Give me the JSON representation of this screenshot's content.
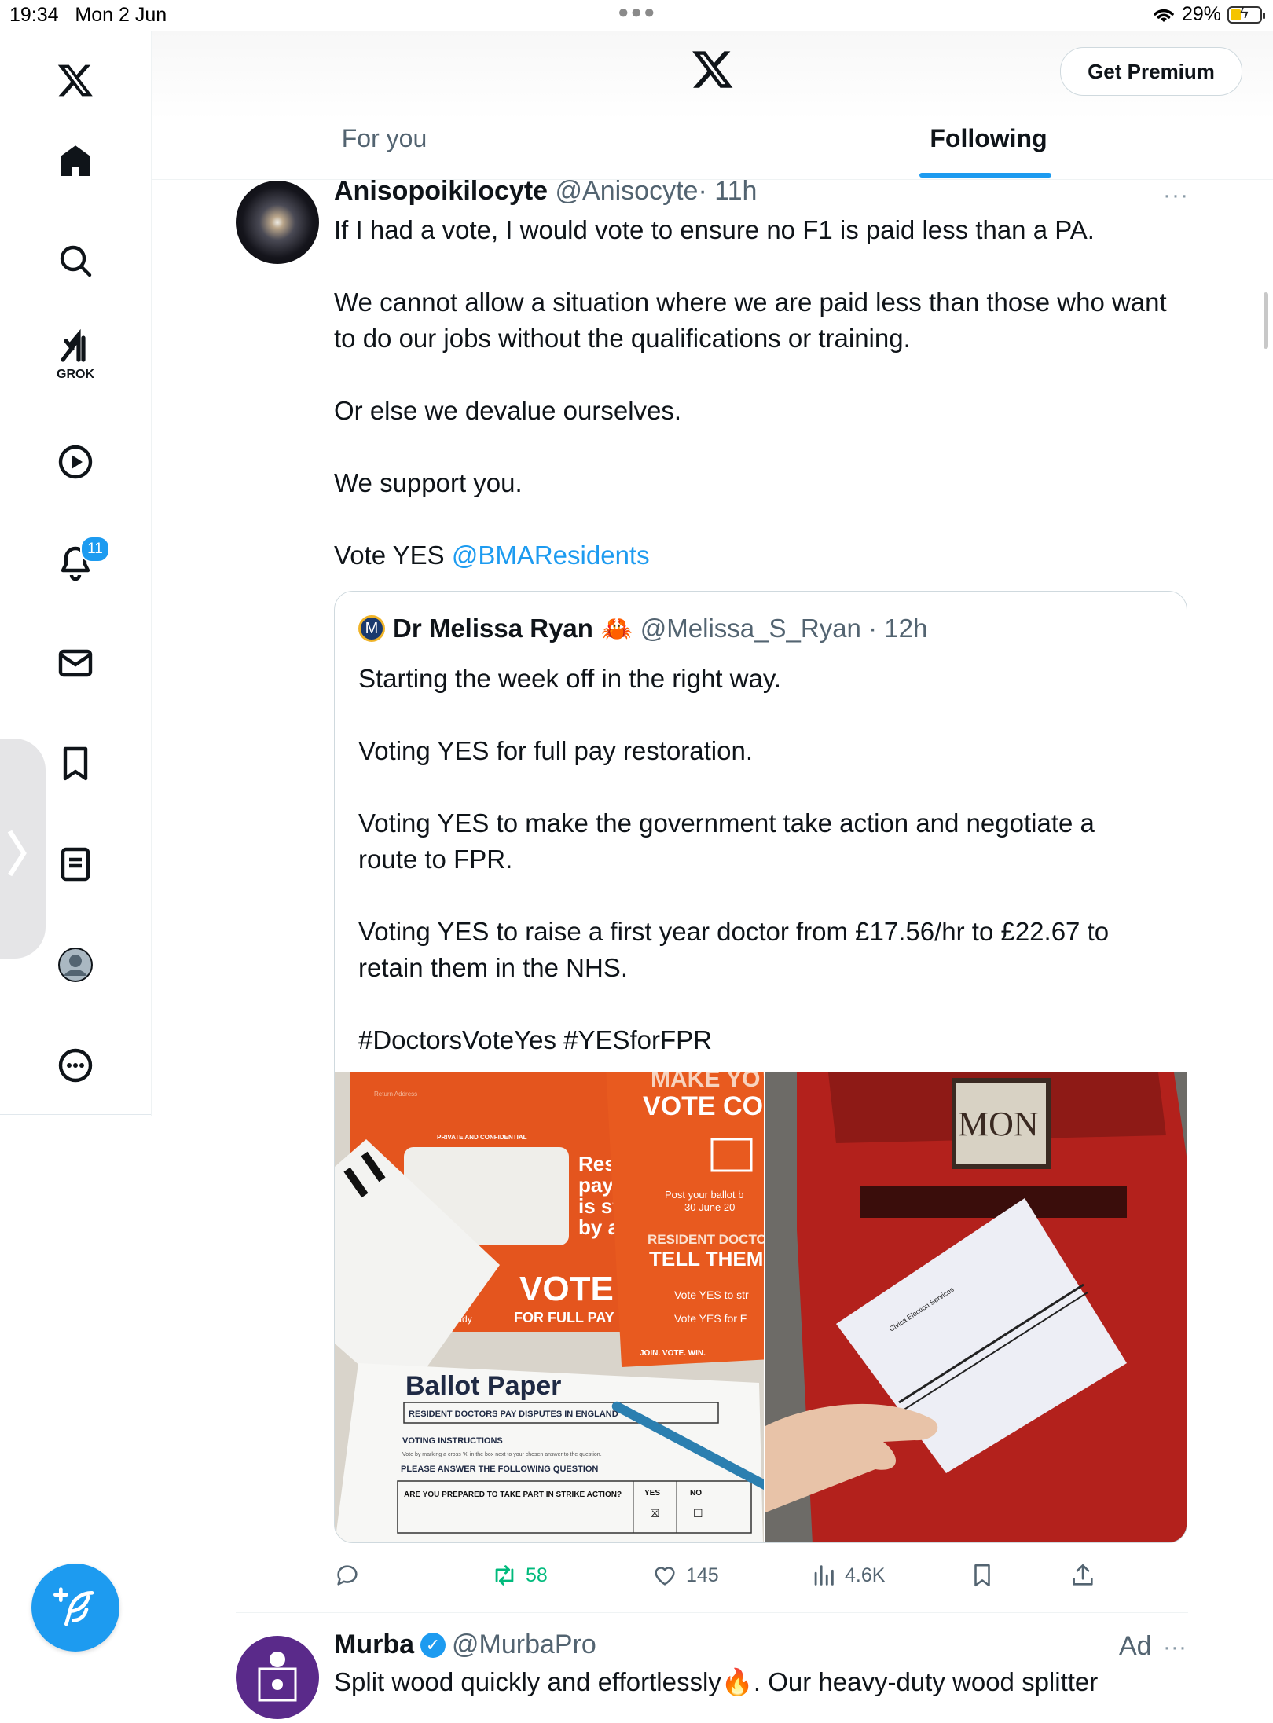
{
  "status_bar": {
    "time": "19:34",
    "date": "Mon 2 Jun",
    "battery": "29%"
  },
  "header": {
    "premium_label": "Get Premium",
    "tabs": [
      {
        "label": "For you"
      },
      {
        "label": "Following"
      }
    ]
  },
  "sidebar": {
    "grok_label": "GROK",
    "notifications_badge": "11",
    "items": [
      "home-icon",
      "search-icon",
      "grok-icon",
      "video-icon",
      "bell-icon",
      "mail-icon",
      "bookmark-icon",
      "notes-icon",
      "profile-icon",
      "more-icon"
    ]
  },
  "tweet": {
    "name": "Anisopoikilocyte",
    "handle": "@Anisocyte",
    "time": "· 11h",
    "more": "···",
    "paragraphs": [
      "If I had a vote, I would vote to ensure no F1 is paid less than a PA.",
      "We cannot allow a situation where we are paid less than those who want to do our jobs without the qualifications or training.",
      "Or else we devalue ourselves.",
      "We support you."
    ],
    "last_prefix": "Vote YES ",
    "last_mention": "@BMAResidents",
    "quote": {
      "avatar_letter": "M",
      "name": "Dr Melissa Ryan",
      "emoji": "🦀",
      "handle": "@Melissa_S_Ryan",
      "time": "· 12h",
      "paragraphs": [
        "Starting the week off in the right way.",
        "Voting YES for full pay restoration.",
        "Voting YES to make the government take action and negotiate a route to FPR.",
        "Voting YES to raise a first year doctor from £17.56/hr to £22.67 to retain them in the NHS.",
        "#DoctorsVoteYes #YESforFPR"
      ],
      "image1": {
        "return_addr": "Return Address",
        "private": "PRIVATE AND CONFIDENTIAL",
        "make_vote": "MAKE YO",
        "vote_count": "VOTE CO",
        "resi": "Resi",
        "pay": "pay i",
        "is_sti": "is sti",
        "by_a": "by a",
        "post_ballot": "Post your ballot b",
        "june": "30 June 20",
        "resident_docto": "RESIDENT DOCTO",
        "tell_them": "TELL THEM",
        "vote_big": "VOTE",
        "full_pay": "FOR FULL PAY",
        "ready": "Ready",
        "vote_yes_str": "Vote YES to str",
        "vote_yes_f": "Vote YES for F",
        "join": "JOIN. VOTE. WIN.",
        "ballot_paper": "Ballot Paper",
        "disputes": "RESIDENT DOCTORS PAY DISPUTES IN ENGLAND",
        "voting_instructions": "VOTING INSTRUCTIONS",
        "instr_line": "Vote by marking a cross 'X' in the box next to your chosen answer to the question.",
        "please_answer": "PLEASE ANSWER THE FOLLOWING QUESTION",
        "question": "ARE YOU PREPARED TO TAKE PART IN STRIKE ACTION?",
        "yes": "YES",
        "no": "NO"
      },
      "image2": {
        "mon": "MON",
        "envelope_text": "Civica Election Services"
      }
    },
    "actions": {
      "reposts": "58",
      "likes": "145",
      "views": "4.6K"
    }
  },
  "ad_tweet": {
    "name": "Murba",
    "handle": "@MurbaPro",
    "ad_label": "Ad",
    "more": "···",
    "text": "Split wood quickly and effortlessly🔥. Our heavy-duty wood splitter"
  },
  "colors": {
    "accent": "#1d9bf0",
    "text": "#0f1419",
    "muted": "#536471",
    "repost": "#00ba7c"
  }
}
